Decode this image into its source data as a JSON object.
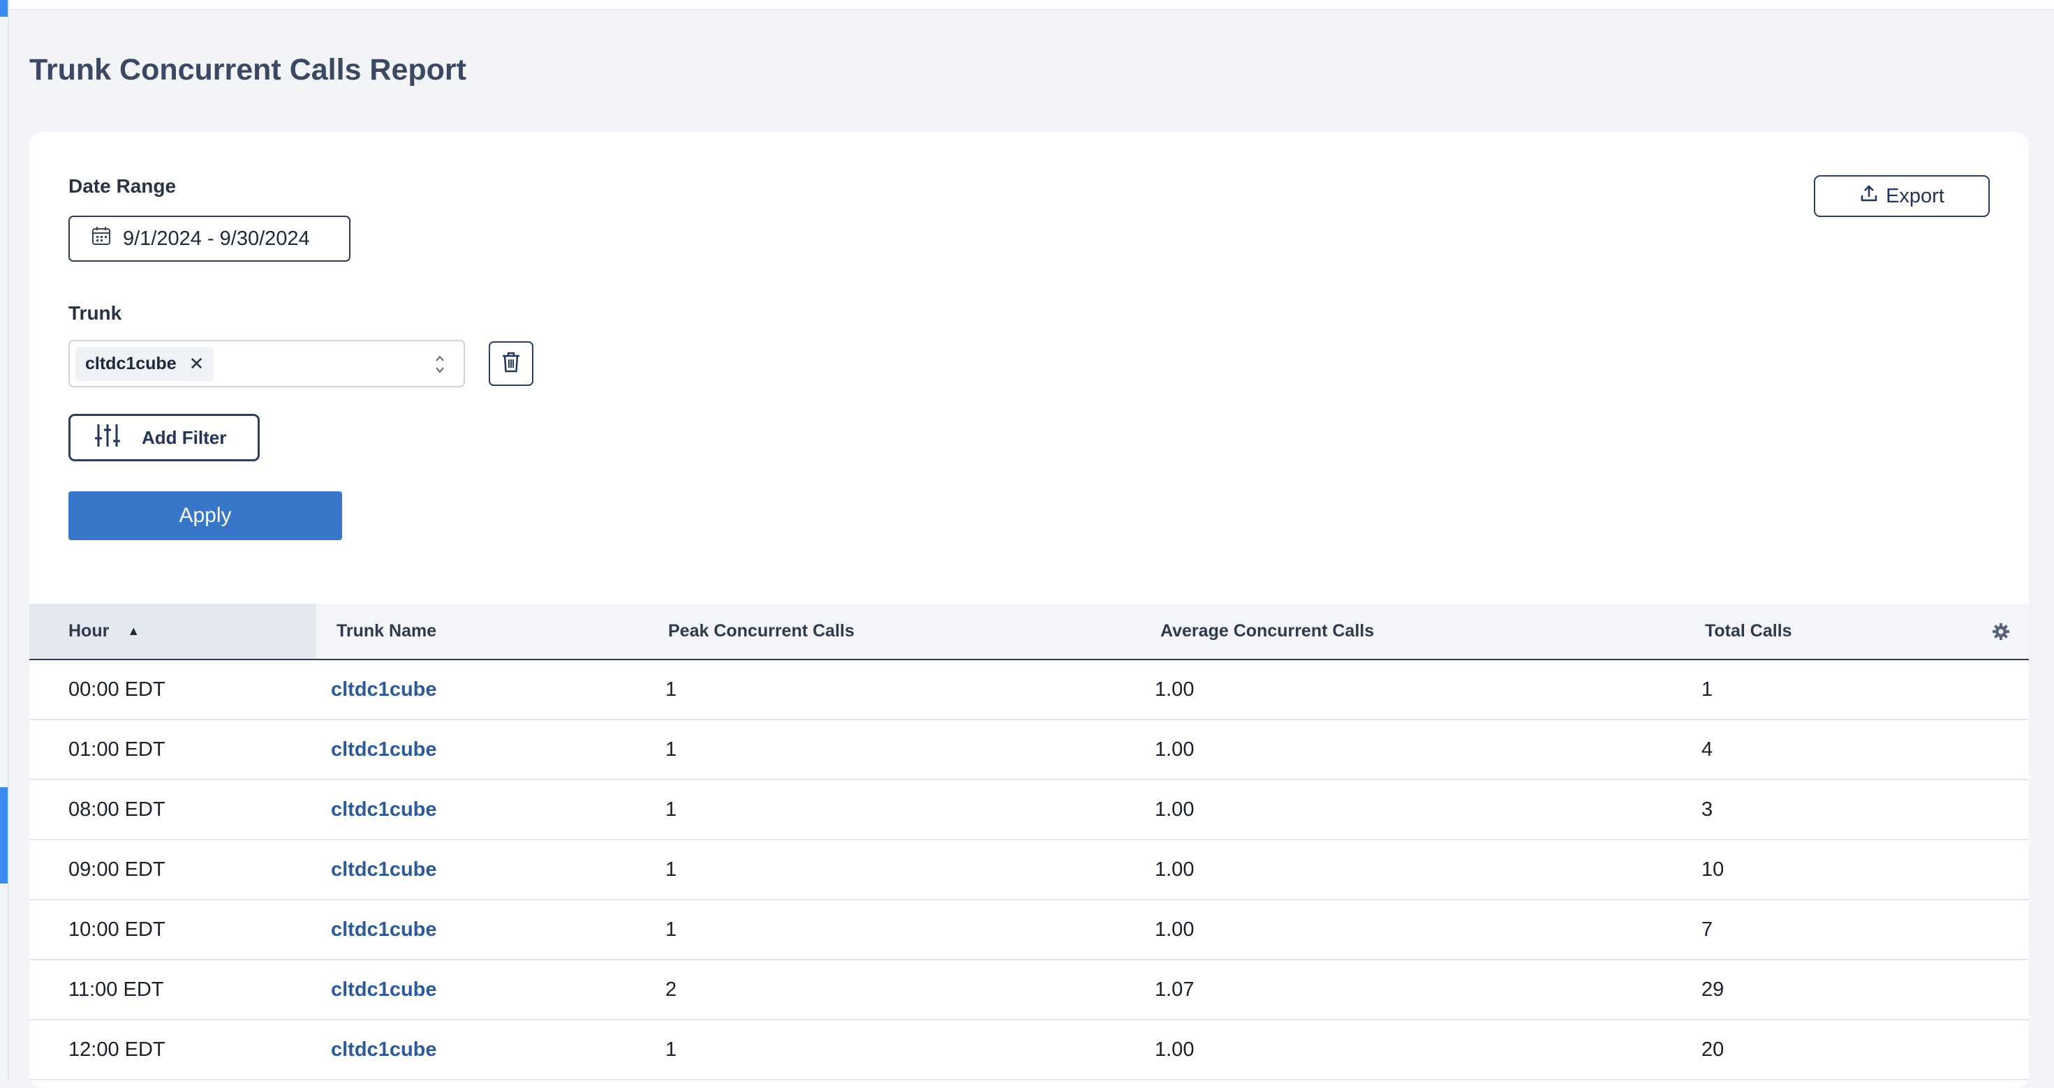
{
  "page": {
    "title": "Trunk Concurrent Calls Report"
  },
  "filters": {
    "date_range_label": "Date Range",
    "date_range_value": "9/1/2024 - 9/30/2024",
    "trunk_label": "Trunk",
    "selected_trunk": "cltdc1cube",
    "add_filter_label": "Add Filter",
    "apply_label": "Apply"
  },
  "toolbar": {
    "export_label": "Export"
  },
  "table": {
    "columns": [
      "Hour",
      "Trunk Name",
      "Peak Concurrent Calls",
      "Average Concurrent Calls",
      "Total Calls"
    ],
    "sort": {
      "column": "Hour",
      "direction": "ascending"
    },
    "rows": [
      {
        "hour": "00:00 EDT",
        "trunk": "cltdc1cube",
        "peak": "1",
        "avg": "1.00",
        "total": "1"
      },
      {
        "hour": "01:00 EDT",
        "trunk": "cltdc1cube",
        "peak": "1",
        "avg": "1.00",
        "total": "4"
      },
      {
        "hour": "08:00 EDT",
        "trunk": "cltdc1cube",
        "peak": "1",
        "avg": "1.00",
        "total": "3"
      },
      {
        "hour": "09:00 EDT",
        "trunk": "cltdc1cube",
        "peak": "1",
        "avg": "1.00",
        "total": "10"
      },
      {
        "hour": "10:00 EDT",
        "trunk": "cltdc1cube",
        "peak": "1",
        "avg": "1.00",
        "total": "7"
      },
      {
        "hour": "11:00 EDT",
        "trunk": "cltdc1cube",
        "peak": "2",
        "avg": "1.07",
        "total": "29"
      },
      {
        "hour": "12:00 EDT",
        "trunk": "cltdc1cube",
        "peak": "1",
        "avg": "1.00",
        "total": "20"
      }
    ]
  },
  "icons": {
    "calendar": "calendar-icon",
    "export": "upload-icon",
    "remove_chip": "close-icon",
    "select_arrows": "chevron-up-down-icon",
    "delete": "trash-icon",
    "filter": "sliders-icon",
    "sort": "sort-ascending-icon",
    "settings": "gear-icon"
  },
  "colors": {
    "accent": "#3776c8",
    "link": "#2d5b98",
    "title": "#3a4863",
    "edge_accent": "#3d8bf2"
  }
}
